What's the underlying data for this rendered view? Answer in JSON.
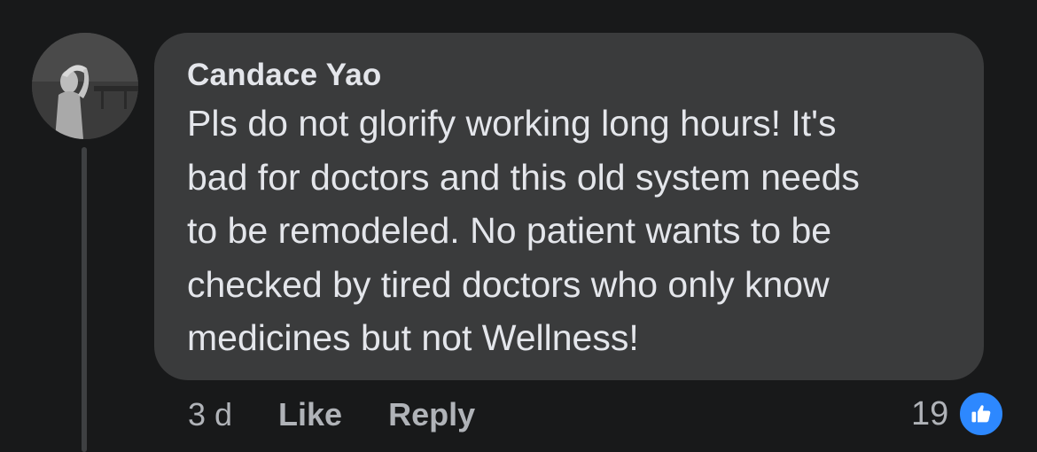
{
  "comment": {
    "author": "Candace Yao",
    "text_lines": [
      "Pls do not glorify working long hours! It's",
      "bad for doctors and this old system needs",
      "to be remodeled. No patient wants to be",
      "checked by tired doctors who only know",
      "medicines but not Wellness!"
    ],
    "time": "3 d",
    "like_label": "Like",
    "reply_label": "Reply",
    "reaction_count": "19",
    "reaction_icon": "thumbs-up-icon"
  },
  "colors": {
    "background": "#18191a",
    "bubble": "#3a3b3c",
    "text_primary": "#e4e6eb",
    "text_secondary": "#b0b3b8",
    "like_blue": "#2d88ff"
  }
}
